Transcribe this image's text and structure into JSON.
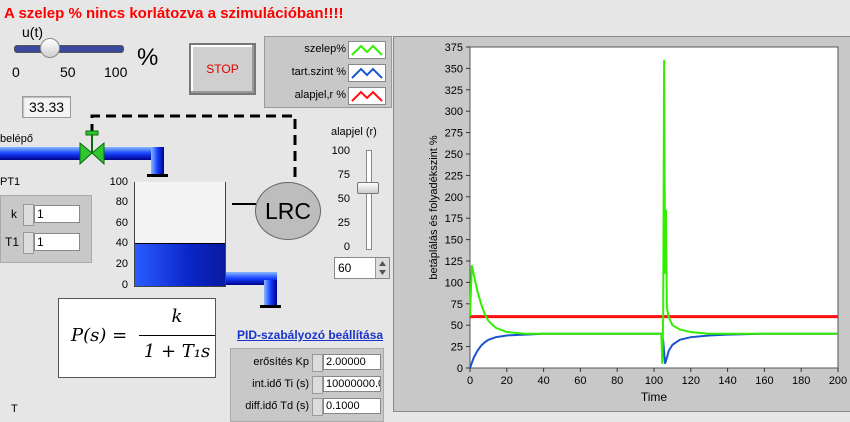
{
  "warning": "A szelep % nincs korlátozva a szimulációban!!!!",
  "u_slider": {
    "title": "u(t)",
    "ticks": [
      "0",
      "50",
      "100"
    ],
    "unit": "%",
    "value": 33.33,
    "display": "33.33"
  },
  "stop_button": {
    "label": "STOP"
  },
  "legend": [
    {
      "name": "szelep%",
      "color": "#33ee00"
    },
    {
      "name": "tart.szint %",
      "color": "#1a55d0"
    },
    {
      "name": "alapjel,r %",
      "color": "#ff1010"
    }
  ],
  "inlet_label": "belépő",
  "tank": {
    "scale": [
      "100",
      "80",
      "60",
      "40",
      "20",
      "0"
    ],
    "level": 40
  },
  "controller_label": "LRC",
  "pt1": {
    "title": "PT1",
    "k_label": "k",
    "k_value": "1",
    "t1_label": "T1",
    "t1_value": "1"
  },
  "formula": {
    "lhs": "P(s) =",
    "numerator": "k",
    "denominator": "1 + T₁s"
  },
  "pid": {
    "title": "PID-szabályozó beállítása",
    "kp_label": "erősítés Kp",
    "kp_value": "2.00000",
    "ti_label": "int.idő Ti (s)",
    "ti_value": "10000000.0",
    "td_label": "diff.idő Td (s)",
    "td_value": "0.1000"
  },
  "setpoint": {
    "title": "alapjel (r)",
    "scale": [
      "100",
      "75",
      "50",
      "25",
      "0"
    ],
    "value": 60,
    "display": "60"
  },
  "bottom_label": "T",
  "chart_data": {
    "type": "line",
    "xlabel": "Time",
    "ylabel": "betáplálás és folyadékszint %",
    "xlim": [
      0,
      200
    ],
    "ylim": [
      0,
      375
    ],
    "x_ticks": [
      0,
      20,
      40,
      60,
      80,
      100,
      120,
      140,
      160,
      180,
      200
    ],
    "y_ticks": [
      0,
      25,
      50,
      75,
      100,
      125,
      150,
      175,
      200,
      225,
      250,
      275,
      300,
      325,
      350,
      375
    ],
    "grid": false,
    "series": [
      {
        "name": "szelep%",
        "color": "#33ee00",
        "x": [
          0,
          1,
          2,
          4,
          6,
          8,
          10,
          14,
          20,
          30,
          40,
          60,
          80,
          100,
          104,
          104.5,
          105,
          105.5,
          106,
          106.5,
          107,
          108,
          110,
          114,
          120,
          130,
          140,
          160,
          180,
          200
        ],
        "y": [
          60,
          120,
          110,
          90,
          75,
          63,
          55,
          47,
          42,
          40,
          40,
          40,
          40,
          40,
          40,
          5,
          60,
          360,
          110,
          185,
          70,
          60,
          50,
          45,
          42,
          40,
          40,
          40,
          40,
          40
        ]
      },
      {
        "name": "tart.szint %",
        "color": "#1a55d0",
        "x": [
          0,
          2,
          4,
          6,
          8,
          10,
          14,
          20,
          30,
          40,
          60,
          80,
          100,
          104,
          105,
          106,
          107,
          108,
          110,
          114,
          120,
          130,
          140,
          160,
          180,
          200
        ],
        "y": [
          0,
          12,
          20,
          26,
          30,
          33,
          36,
          38,
          39,
          40,
          40,
          40,
          40,
          40,
          32,
          5,
          12,
          20,
          27,
          33,
          36,
          38,
          39,
          40,
          40,
          40
        ]
      },
      {
        "name": "alapjel,r %",
        "color": "#ff1010",
        "x": [
          0,
          200
        ],
        "y": [
          60,
          60
        ]
      }
    ]
  }
}
